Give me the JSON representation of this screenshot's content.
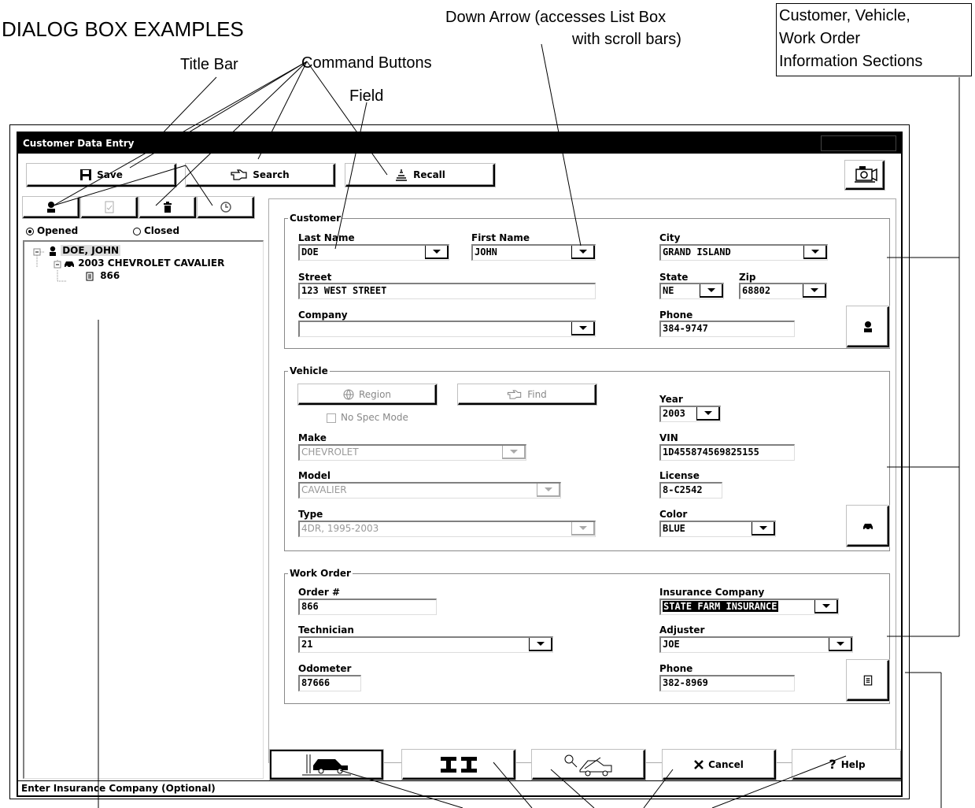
{
  "annotations": {
    "page_title": "DIALOG BOX EXAMPLES",
    "title_bar": "Title Bar",
    "command_buttons": "Command Buttons",
    "field": "Field",
    "down_arrow_line1": "Down Arrow (accesses List Box",
    "down_arrow_line2": "with scroll bars)",
    "sections_line1": "Customer, Vehicle,",
    "sections_line2": "Work Order",
    "sections_line3": "Information Sections"
  },
  "window": {
    "title": "Customer Data Entry",
    "status": "Enter Insurance Company (Optional)"
  },
  "toolbar": {
    "save_label": "Save",
    "search_label": "Search",
    "recall_label": "Recall"
  },
  "left_panel": {
    "opened_label": "Opened",
    "closed_label": "Closed",
    "opened_selected": true,
    "tree": {
      "customer": "DOE, JOHN",
      "vehicle": "2003 CHEVROLET CAVALIER",
      "order": "866"
    }
  },
  "customer": {
    "section_label": "Customer",
    "last_name_label": "Last Name",
    "last_name": "DOE",
    "first_name_label": "First Name",
    "first_name": "JOHN",
    "street_label": "Street",
    "street": "123 WEST STREET",
    "company_label": "Company",
    "company": "",
    "city_label": "City",
    "city": "GRAND ISLAND",
    "state_label": "State",
    "state": "NE",
    "zip_label": "Zip",
    "zip": "68802",
    "phone_label": "Phone",
    "phone": "384-9747"
  },
  "vehicle": {
    "section_label": "Vehicle",
    "region_label": "Region",
    "find_label": "Find",
    "no_spec_label": "No Spec Mode",
    "make_label": "Make",
    "make": "CHEVROLET",
    "model_label": "Model",
    "model": "CAVALIER",
    "type_label": "Type",
    "type": "4DR, 1995-2003",
    "year_label": "Year",
    "year": "2003",
    "vin_label": "VIN",
    "vin": "1D455874569825155",
    "license_label": "License",
    "license": "8-C2542",
    "color_label": "Color",
    "color": "BLUE"
  },
  "work_order": {
    "section_label": "Work Order",
    "order_label": "Order #",
    "order": "866",
    "technician_label": "Technician",
    "technician": "21",
    "odometer_label": "Odometer",
    "odometer": "87666",
    "insurance_label": "Insurance Company",
    "insurance": "STATE FARM INSURANCE",
    "adjuster_label": "Adjuster",
    "adjuster": "JOE",
    "phone_label": "Phone",
    "phone": "382-8969"
  },
  "bottom": {
    "cancel_label": "Cancel",
    "help_label": "Help"
  }
}
